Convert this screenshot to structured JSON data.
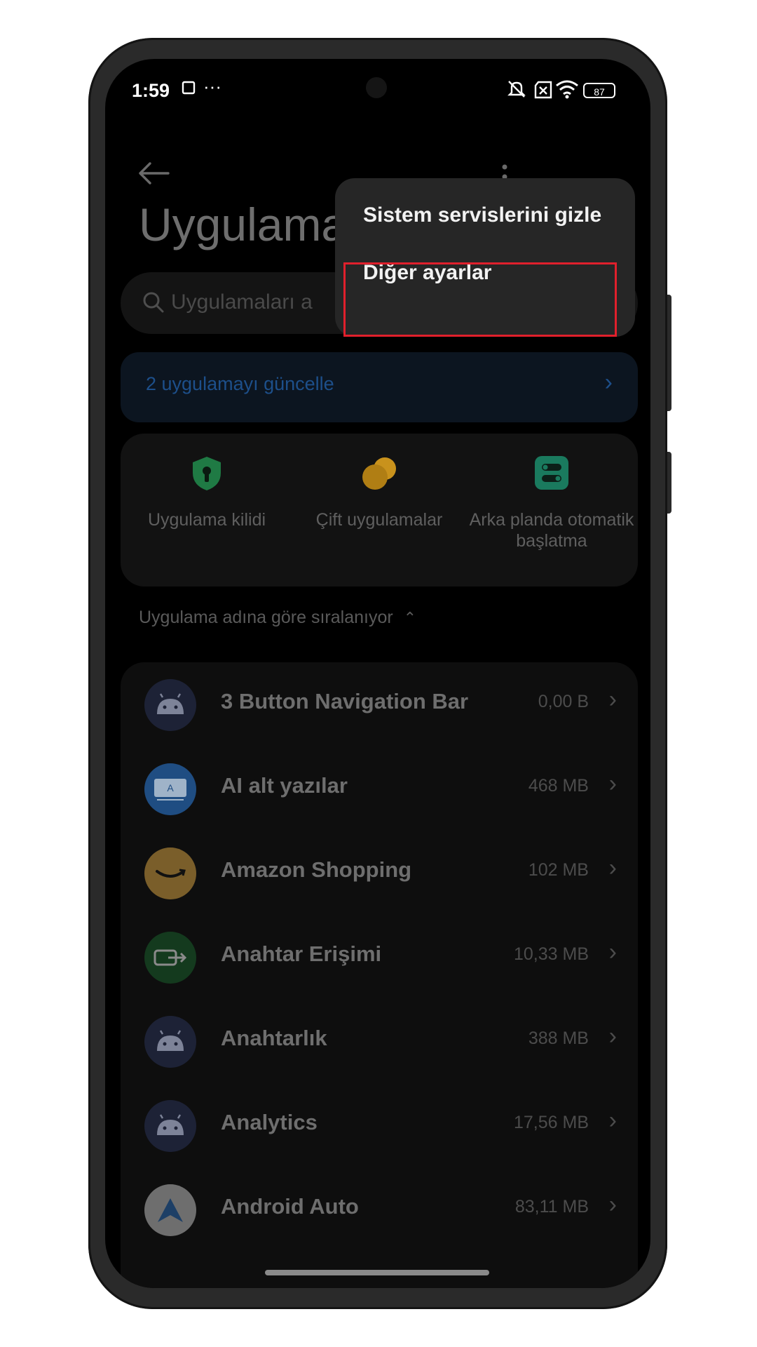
{
  "status_bar": {
    "time": "1:59",
    "icons_left": [
      "screen-record-icon",
      "more-dots-icon"
    ],
    "icons_right": [
      "mute-icon",
      "sim-off-icon",
      "wifi-icon"
    ],
    "battery": "87"
  },
  "toolbar": {
    "back_icon": "back-arrow-icon",
    "more_icon": "more-vertical-icon"
  },
  "page": {
    "title": "Uygulama",
    "search_placeholder": "Uygulamaları a"
  },
  "update_banner": {
    "label": "2 uygulamayı güncelle",
    "chevron": "›"
  },
  "quick_actions": [
    {
      "label": "Uygulama kilidi",
      "icon": "shield-lock-icon",
      "color": "#1f8a4a"
    },
    {
      "label": "Çift uygulamalar",
      "icon": "dual-apps-icon",
      "color": "#d69a1a"
    },
    {
      "label": "Arka planda otomatik başlatma",
      "icon": "autostart-toggle-icon",
      "color": "#1f9a72"
    }
  ],
  "sort": {
    "label": "Uygulama adına göre sıralanıyor",
    "icon": "sort-updown-icon"
  },
  "apps": [
    {
      "name": "3 Button Navigation Bar",
      "size": "0,00 B",
      "icon": "android-icon"
    },
    {
      "name": "AI alt yazılar",
      "size": "468 MB",
      "icon": "ai-subtitles-icon"
    },
    {
      "name": "Amazon Shopping",
      "size": "102 MB",
      "icon": "amazon-icon"
    },
    {
      "name": "Anahtar Erişimi",
      "size": "10,33 MB",
      "icon": "key-access-icon"
    },
    {
      "name": "Anahtarlık",
      "size": "388 MB",
      "icon": "android-icon"
    },
    {
      "name": "Analytics",
      "size": "17,56 MB",
      "icon": "android-icon"
    },
    {
      "name": "Android Auto",
      "size": "83,11 MB",
      "icon": "android-auto-icon"
    }
  ],
  "overflow_menu": {
    "items": [
      "Sistem servislerini gizle",
      "Diğer ayarlar"
    ],
    "highlighted_index": 1
  },
  "colors": {
    "accent_blue": "#1d4f8a",
    "highlight_red": "#e0202c",
    "menu_bg": "#262626"
  }
}
